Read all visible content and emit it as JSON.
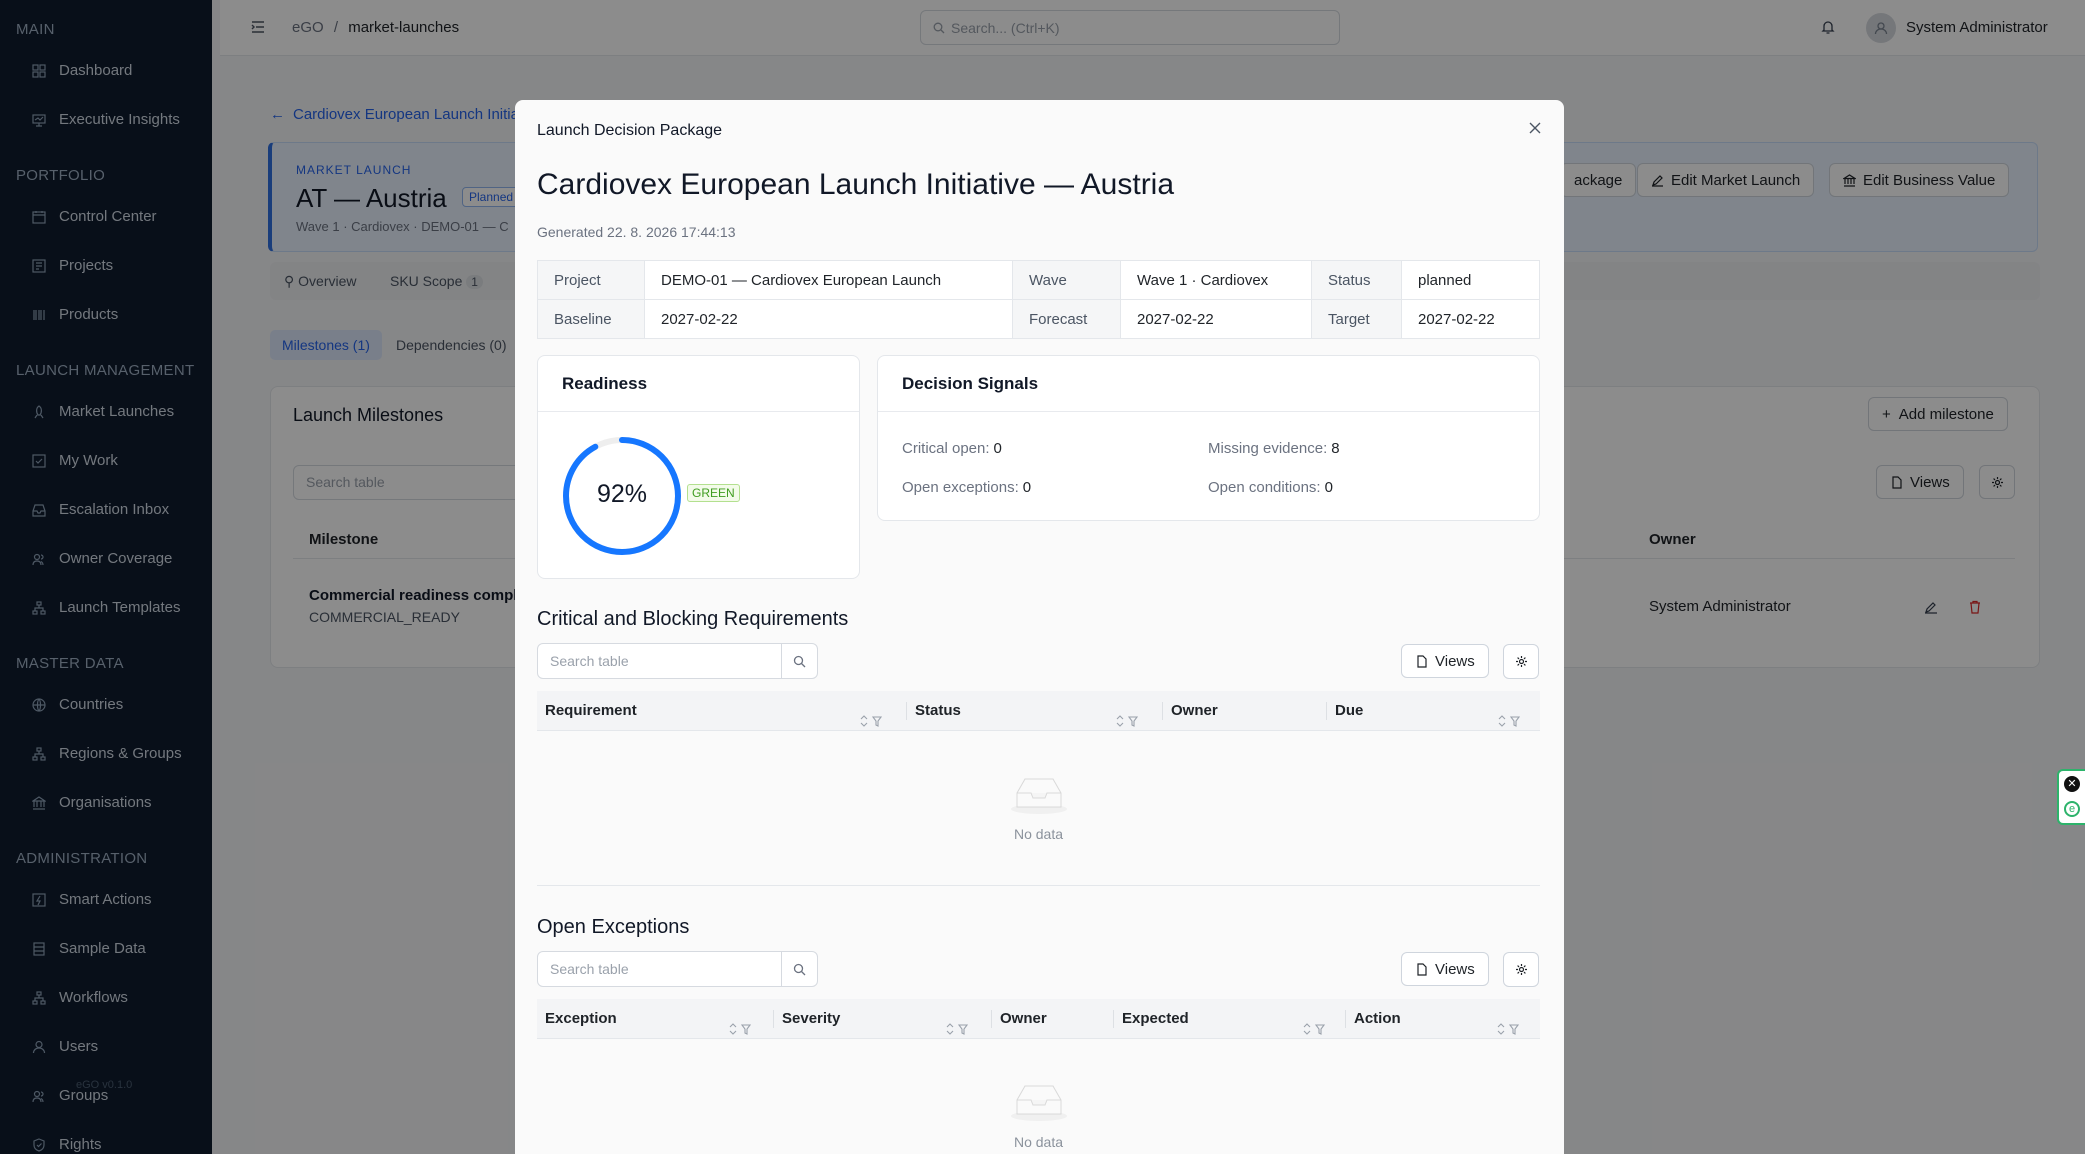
{
  "sidebar": {
    "sections": [
      {
        "title": "MAIN",
        "items": [
          {
            "label": "Dashboard",
            "icon": "grid-icon"
          },
          {
            "label": "Executive Insights",
            "icon": "presentation-icon"
          }
        ]
      },
      {
        "title": "PORTFOLIO",
        "items": [
          {
            "label": "Control Center",
            "icon": "calendar-icon"
          },
          {
            "label": "Projects",
            "icon": "project-icon"
          },
          {
            "label": "Products",
            "icon": "barcode-icon"
          }
        ]
      },
      {
        "title": "LAUNCH MANAGEMENT",
        "items": [
          {
            "label": "Market Launches",
            "icon": "rocket-icon"
          },
          {
            "label": "My Work",
            "icon": "checklist-icon"
          },
          {
            "label": "Escalation Inbox",
            "icon": "inbox-icon"
          },
          {
            "label": "Owner Coverage",
            "icon": "users-icon"
          },
          {
            "label": "Launch Templates",
            "icon": "hierarchy-icon"
          }
        ]
      },
      {
        "title": "MASTER DATA",
        "items": [
          {
            "label": "Countries",
            "icon": "globe-icon"
          },
          {
            "label": "Regions & Groups",
            "icon": "hierarchy-icon"
          },
          {
            "label": "Organisations",
            "icon": "bank-icon"
          }
        ]
      },
      {
        "title": "ADMINISTRATION",
        "items": [
          {
            "label": "Smart Actions",
            "icon": "bolt-icon"
          },
          {
            "label": "Sample Data",
            "icon": "database-icon"
          },
          {
            "label": "Workflows",
            "icon": "hierarchy-icon"
          },
          {
            "label": "Users",
            "icon": "user-icon"
          },
          {
            "label": "Groups",
            "icon": "users-icon"
          },
          {
            "label": "Rights",
            "icon": "shield-icon"
          }
        ]
      }
    ],
    "version": "eGO v0.1.0"
  },
  "topbar": {
    "breadcrumb_root": "eGO",
    "breadcrumb_sep": "/",
    "breadcrumb_current": "market-launches",
    "search_placeholder": "Search... (Ctrl+K)",
    "user_name": "System Administrator"
  },
  "page": {
    "back_link": "Cardiovex European Launch Initia",
    "eyebrow": "MARKET LAUNCH",
    "title": "AT — Austria",
    "status_badge": "Planned",
    "subtitle": "Wave 1 · Cardiovex · DEMO-01 — C",
    "btn_package": "ackage",
    "btn_edit": "Edit Market Launch",
    "btn_business_value": "Edit Business Value",
    "tabs": [
      {
        "label": "Overview"
      },
      {
        "label": "SKU Scope",
        "count": "1"
      }
    ],
    "subtabs": [
      {
        "label": "Milestones (1)",
        "active": true
      },
      {
        "label": "Dependencies (0)",
        "active": false
      }
    ],
    "milestones": {
      "title": "Launch Milestones",
      "add_button": "Add milestone",
      "search_placeholder": "Search table",
      "views_label": "Views",
      "col_milestone": "Milestone",
      "col_owner": "Owner",
      "row": {
        "title": "Commercial readiness comple",
        "code": "COMMERCIAL_READY",
        "owner": "System Administrator"
      }
    }
  },
  "modal": {
    "header": "Launch Decision Package",
    "title": "Cardiovex European Launch Initiative — Austria",
    "generated": "Generated 22. 8. 2026 17:44:13",
    "info": {
      "project_label": "Project",
      "project_value": "DEMO-01 — Cardiovex European Launch",
      "wave_label": "Wave",
      "wave_value": "Wave 1 · Cardiovex",
      "status_label": "Status",
      "status_value": "planned",
      "baseline_label": "Baseline",
      "baseline_value": "2027-02-22",
      "forecast_label": "Forecast",
      "forecast_value": "2027-02-22",
      "target_label": "Target",
      "target_value": "2027-02-22"
    },
    "readiness": {
      "title": "Readiness",
      "percent_text": "92%",
      "percent": 92,
      "rag": "GREEN",
      "ring_color": "#1677ff"
    },
    "signals": {
      "title": "Decision Signals",
      "critical_open_label": "Critical open",
      "critical_open": "0",
      "missing_evidence_label": "Missing evidence",
      "missing_evidence": "8",
      "open_exceptions_label": "Open exceptions",
      "open_exceptions": "0",
      "open_conditions_label": "Open conditions",
      "open_conditions": "0"
    },
    "critical": {
      "title": "Critical and Blocking Requirements",
      "search_placeholder": "Search table",
      "views_label": "Views",
      "columns": [
        "Requirement",
        "Status",
        "Owner",
        "Due"
      ],
      "empty": "No data"
    },
    "exceptions": {
      "title": "Open Exceptions",
      "search_placeholder": "Search table",
      "views_label": "Views",
      "columns": [
        "Exception",
        "Severity",
        "Owner",
        "Expected",
        "Action"
      ],
      "empty": "No data"
    }
  }
}
